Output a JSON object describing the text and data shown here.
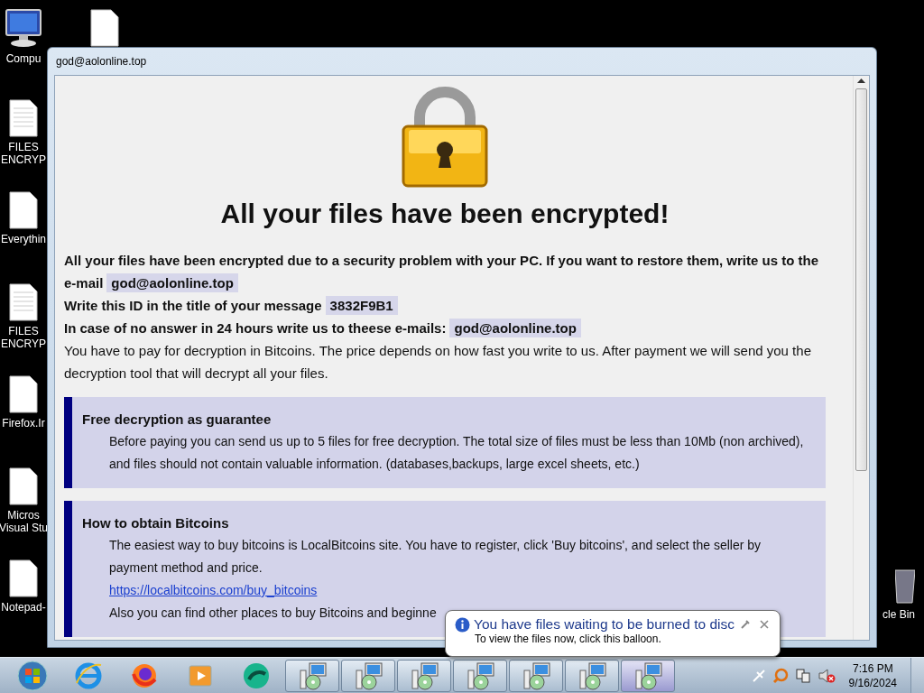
{
  "desktop_icons": [
    {
      "kind": "computer",
      "lines": [
        "Compu"
      ]
    },
    {
      "kind": "text_file",
      "lines": [
        "FILES",
        "ENCRYP"
      ]
    },
    {
      "kind": "file",
      "lines": [
        "Everythin"
      ]
    },
    {
      "kind": "text_file",
      "lines": [
        "FILES",
        "ENCRYP"
      ]
    },
    {
      "kind": "file",
      "lines": [
        "Firefox.Ir"
      ]
    },
    {
      "kind": "file",
      "lines": [
        "Micros",
        "Visual Stu"
      ]
    },
    {
      "kind": "file",
      "lines": [
        "Notepad-"
      ]
    }
  ],
  "top_icon": {
    "kind": "file"
  },
  "recycle_bin": {
    "label": "cle Bin"
  },
  "window": {
    "title": "god@aolonline.top",
    "heading": "All your files have been encrypted!",
    "notices": [
      {
        "kind": "bold",
        "text": "All your files have been encrypted due to a security problem with your PC. If you want to restore them, write us to the e-mail",
        "tag": "god@aolonline.top"
      },
      {
        "kind": "bold",
        "text": "Write this ID in the title of your message",
        "tag": "3832F9B1"
      },
      {
        "kind": "bold",
        "text": "In case of no answer in 24 hours write us to theese e-mails:",
        "tag": "god@aolonline.top"
      },
      {
        "kind": "plain",
        "text": "You have to pay for decryption in Bitcoins. The price depends on how fast you write to us. After payment we will send you the decryption tool that will decrypt all your files."
      }
    ],
    "sections": [
      {
        "title": "Free decryption as guarantee",
        "body": [
          "Before paying you can send us up to 5 files for free decryption. The total size of files must be less than 10Mb (non archived), and files should not contain valuable information. (databases,backups, large excel sheets, etc.)"
        ]
      },
      {
        "title": "How to obtain Bitcoins",
        "body": [
          "The easiest way to buy bitcoins is LocalBitcoins site. You have to register, click 'Buy bitcoins', and select the seller by payment method and price."
        ],
        "link": "https://localbitcoins.com/buy_bitcoins",
        "after": "Also you can find other places to buy Bitcoins and beginne"
      }
    ]
  },
  "balloon": {
    "title": "You have files waiting to be burned to disc",
    "text": "To view the files now, click this balloon."
  },
  "taskbar": {
    "pinned": [
      {
        "kind": "ie"
      },
      {
        "kind": "firefox"
      },
      {
        "kind": "media"
      },
      {
        "kind": "green"
      }
    ],
    "tasks": [
      {
        "selected": false
      },
      {
        "selected": false
      },
      {
        "selected": false
      },
      {
        "selected": false
      },
      {
        "selected": false
      },
      {
        "selected": false
      },
      {
        "selected": true
      }
    ],
    "time": "7:16 PM",
    "date": "9/16/2024"
  }
}
